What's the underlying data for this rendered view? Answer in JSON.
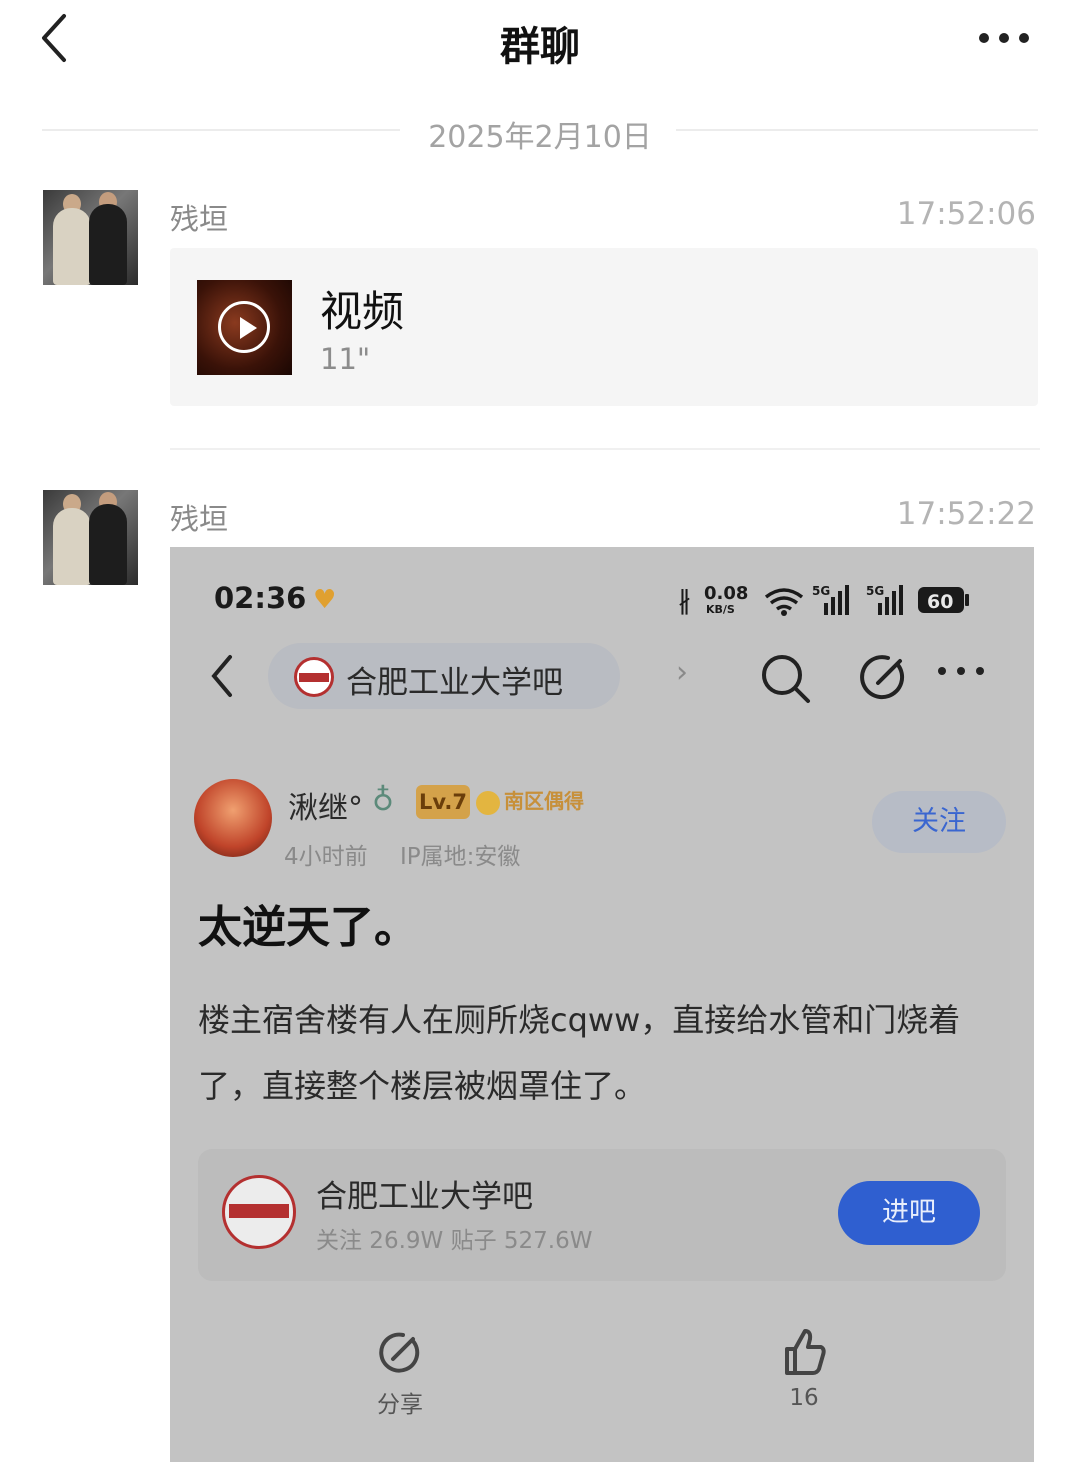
{
  "header": {
    "title": "群聊"
  },
  "date_divider": "2025年2月10日",
  "messages": [
    {
      "sender": "残垣",
      "time": "17:52:06",
      "video": {
        "title": "视频",
        "duration": "11\""
      }
    },
    {
      "sender": "残垣",
      "time": "17:52:22",
      "screenshot": {
        "status_time": "02:36",
        "network_speed": "0.08",
        "network_unit": "KB/S",
        "signal1": "5G",
        "signal2": "5G",
        "battery": "60",
        "forum_pill": "合肥工业大学吧",
        "user": {
          "name": "湫继°",
          "level": "Lv.7",
          "badge": "南区偶得",
          "time_ago": "4小时前",
          "ip": "IP属地:安徽"
        },
        "follow_button": "关注",
        "post_title": "太逆天了。",
        "post_body": "楼主宿舍楼有人在厕所烧cqww，直接给水管和门烧着了，直接整个楼层被烟罩住了。",
        "forum_card": {
          "name": "合肥工业大学吧",
          "stats": "关注 26.9W  贴子 527.6W",
          "button": "进吧"
        },
        "share_label": "分享",
        "like_count": "16"
      }
    }
  ],
  "colors": {
    "accent": "#2f5fd0",
    "background": "#ffffff",
    "screenshot_bg": "#c3c3c3"
  }
}
